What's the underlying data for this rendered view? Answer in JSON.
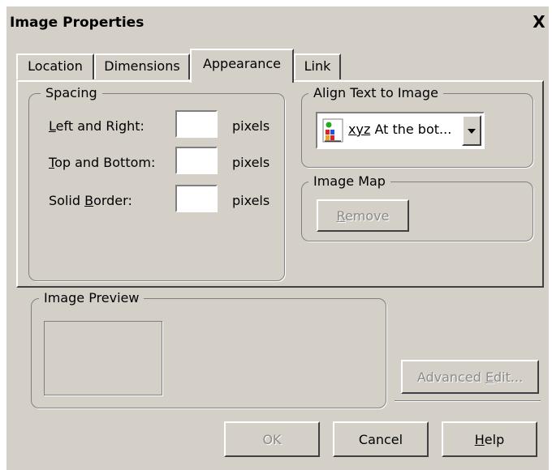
{
  "window": {
    "title": "Image Properties",
    "close_glyph": "X"
  },
  "tabs": [
    {
      "label": "Location",
      "active": false
    },
    {
      "label": "Dimensions",
      "active": false
    },
    {
      "label": "Appearance",
      "active": true
    },
    {
      "label": "Link",
      "active": false
    }
  ],
  "spacing": {
    "legend": "Spacing",
    "unit": "pixels",
    "fields": [
      {
        "label_pre": "",
        "label_key": "L",
        "label_post": "eft and Right:",
        "value": ""
      },
      {
        "label_pre": "",
        "label_key": "T",
        "label_post": "op and Bottom:",
        "value": ""
      },
      {
        "label_pre": "Solid ",
        "label_key": "B",
        "label_post": "order:",
        "value": ""
      }
    ]
  },
  "align": {
    "legend": "Align Text to Image",
    "sample_text": "xyz",
    "selected": "At the bot...",
    "icon": "align-bottom-icon"
  },
  "image_map": {
    "legend": "Image Map",
    "remove_key": "R",
    "remove_post": "emove"
  },
  "preview": {
    "legend": "Image Preview"
  },
  "advanced": {
    "pre": "Advanced ",
    "key": "E",
    "post": "dit..."
  },
  "footer": {
    "ok": "OK",
    "cancel": "Cancel",
    "help_key": "H",
    "help_post": "elp"
  },
  "colors": {
    "dialog_bg": "#d4d0c8",
    "disabled_text": "#8a8a8a"
  }
}
